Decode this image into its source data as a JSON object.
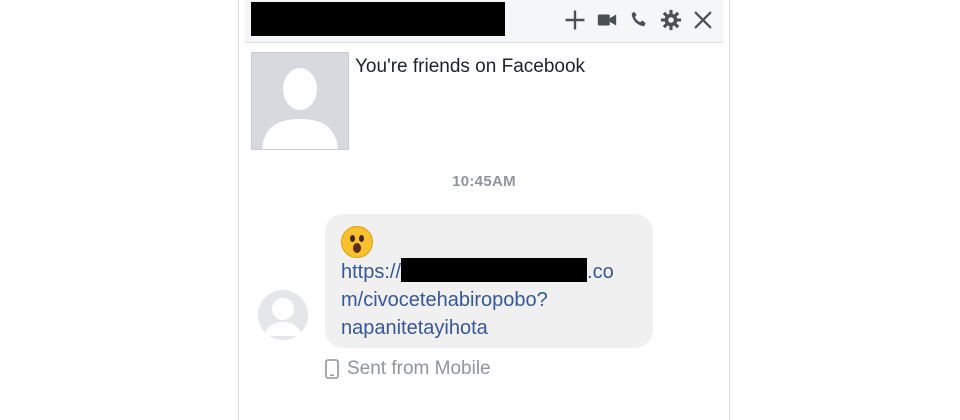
{
  "header": {
    "icons": [
      "plus-icon",
      "video-camera-icon",
      "phone-icon",
      "gear-icon",
      "close-icon"
    ]
  },
  "conversation": {
    "intro_text": "You're friends on Facebook",
    "timestamp": "10:45AM"
  },
  "message": {
    "emoji": "astonished-face-icon",
    "link_prefix": "https://",
    "link_suffix_line1": ".co",
    "link_line2": "m/civocetehabiropobo?",
    "link_line3": "napanitetayihota"
  },
  "footer": {
    "sent_from": "Sent from Mobile"
  },
  "colors": {
    "link": "#365899",
    "bubble": "#f1f0f0",
    "muted_text": "#90949c"
  }
}
